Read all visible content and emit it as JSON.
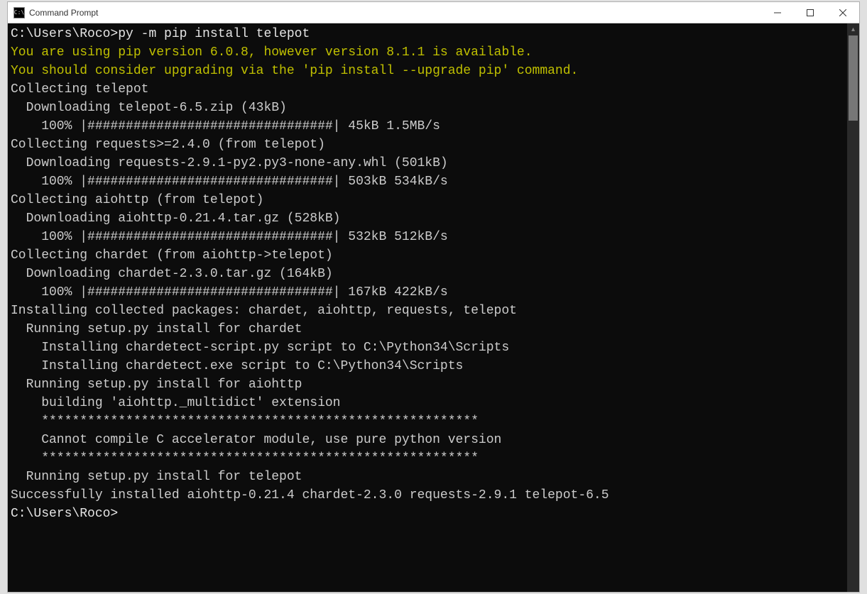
{
  "window": {
    "title": "Command Prompt",
    "icon_text": "C:\\"
  },
  "prompt1_path": "C:\\Users\\Roco>",
  "prompt1_cmd": "py -m pip install telepot",
  "lines": {
    "warn1": "You are using pip version 6.0.8, however version 8.1.1 is available.",
    "warn2": "You should consider upgrading via the 'pip install --upgrade pip' command.",
    "l01": "Collecting telepot",
    "l02": "  Downloading telepot-6.5.zip (43kB)",
    "l03": "    100% |################################| 45kB 1.5MB/s",
    "l04": "Collecting requests>=2.4.0 (from telepot)",
    "l05": "  Downloading requests-2.9.1-py2.py3-none-any.whl (501kB)",
    "l06": "    100% |################################| 503kB 534kB/s",
    "l07": "Collecting aiohttp (from telepot)",
    "l08": "  Downloading aiohttp-0.21.4.tar.gz (528kB)",
    "l09": "    100% |################################| 532kB 512kB/s",
    "l10": "Collecting chardet (from aiohttp->telepot)",
    "l11": "  Downloading chardet-2.3.0.tar.gz (164kB)",
    "l12": "    100% |################################| 167kB 422kB/s",
    "l13": "Installing collected packages: chardet, aiohttp, requests, telepot",
    "l14": "  Running setup.py install for chardet",
    "l15": "    Installing chardetect-script.py script to C:\\Python34\\Scripts",
    "l16": "    Installing chardetect.exe script to C:\\Python34\\Scripts",
    "l17": "  Running setup.py install for aiohttp",
    "l18": "    building 'aiohttp._multidict' extension",
    "l19": "    *********************************************************",
    "l20": "    Cannot compile C accelerator module, use pure python version",
    "l21": "    *********************************************************",
    "l22": "",
    "l23": "  Running setup.py install for telepot",
    "l24": "Successfully installed aiohttp-0.21.4 chardet-2.3.0 requests-2.9.1 telepot-6.5",
    "l25": ""
  },
  "prompt2": "C:\\Users\\Roco>"
}
